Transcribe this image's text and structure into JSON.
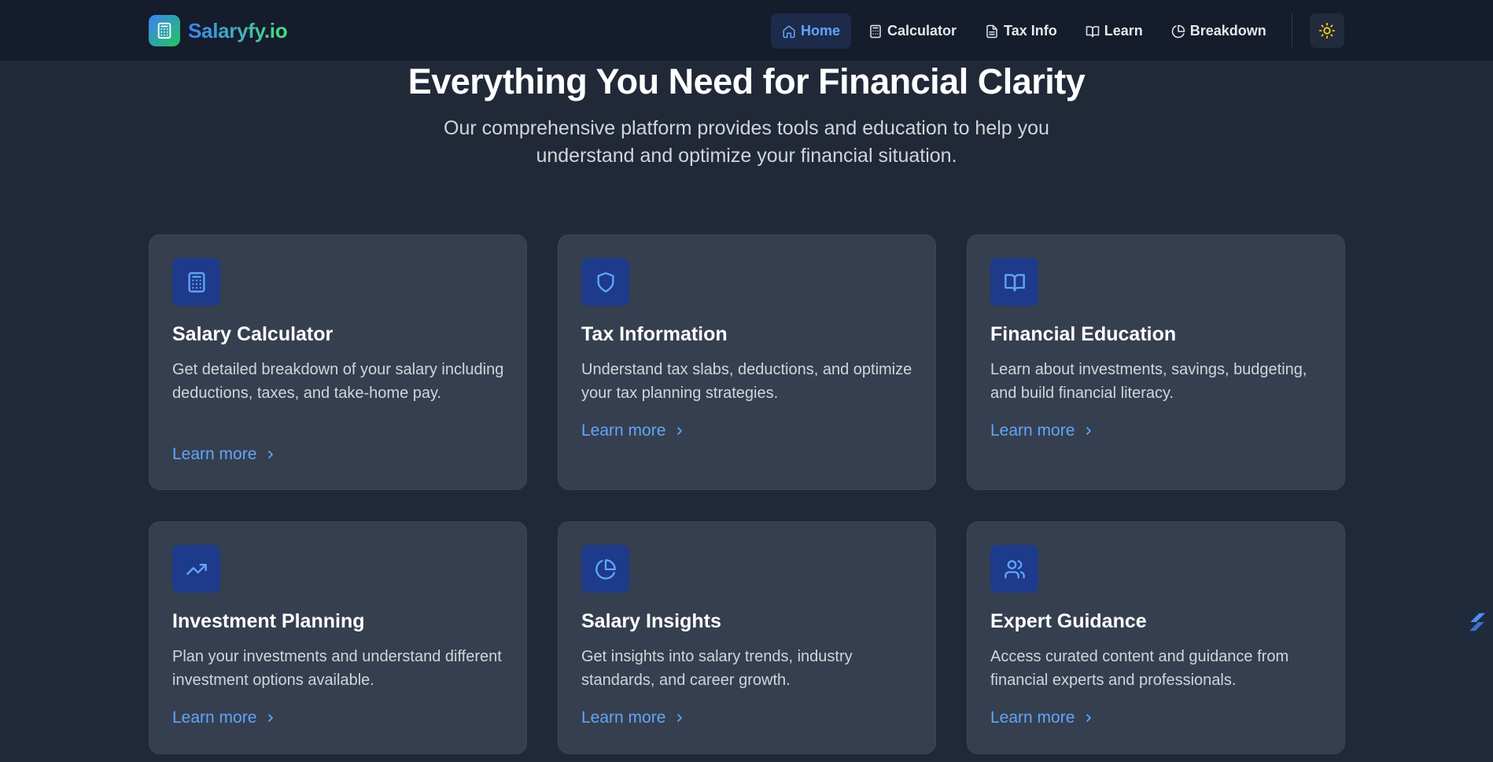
{
  "brand": {
    "name": "Salaryfy.io",
    "logo_icon": "calculator-icon",
    "accent": "#60a5fa"
  },
  "nav": {
    "items": [
      {
        "label": "Home",
        "icon": "home-icon",
        "active": true
      },
      {
        "label": "Calculator",
        "icon": "calculator-icon",
        "active": false
      },
      {
        "label": "Tax Info",
        "icon": "file-text-icon",
        "active": false
      },
      {
        "label": "Learn",
        "icon": "book-open-icon",
        "active": false
      },
      {
        "label": "Breakdown",
        "icon": "pie-chart-icon",
        "active": false
      }
    ],
    "theme_toggle_icon": "sun-icon"
  },
  "hero": {
    "title": "Everything You Need for Financial Clarity",
    "subtitle": "Our comprehensive platform provides tools and education to help you understand and optimize your financial situation."
  },
  "features": [
    {
      "icon": "calculator-icon",
      "title": "Salary Calculator",
      "description": "Get detailed breakdown of your salary including deductions, taxes, and take-home pay.",
      "link": "Learn more"
    },
    {
      "icon": "shield-icon",
      "title": "Tax Information",
      "description": "Understand tax slabs, deductions, and optimize your tax planning strategies.",
      "link": "Learn more"
    },
    {
      "icon": "book-open-icon",
      "title": "Financial Education",
      "description": "Learn about investments, savings, budgeting, and build financial literacy.",
      "link": "Learn more"
    },
    {
      "icon": "trending-up-icon",
      "title": "Investment Planning",
      "description": "Plan your investments and understand different investment options available.",
      "link": "Learn more"
    },
    {
      "icon": "pie-chart-icon",
      "title": "Salary Insights",
      "description": "Get insights into salary trends, industry standards, and career growth.",
      "link": "Learn more"
    },
    {
      "icon": "users-icon",
      "title": "Expert Guidance",
      "description": "Access curated content and guidance from financial experts and professionals.",
      "link": "Learn more"
    }
  ]
}
